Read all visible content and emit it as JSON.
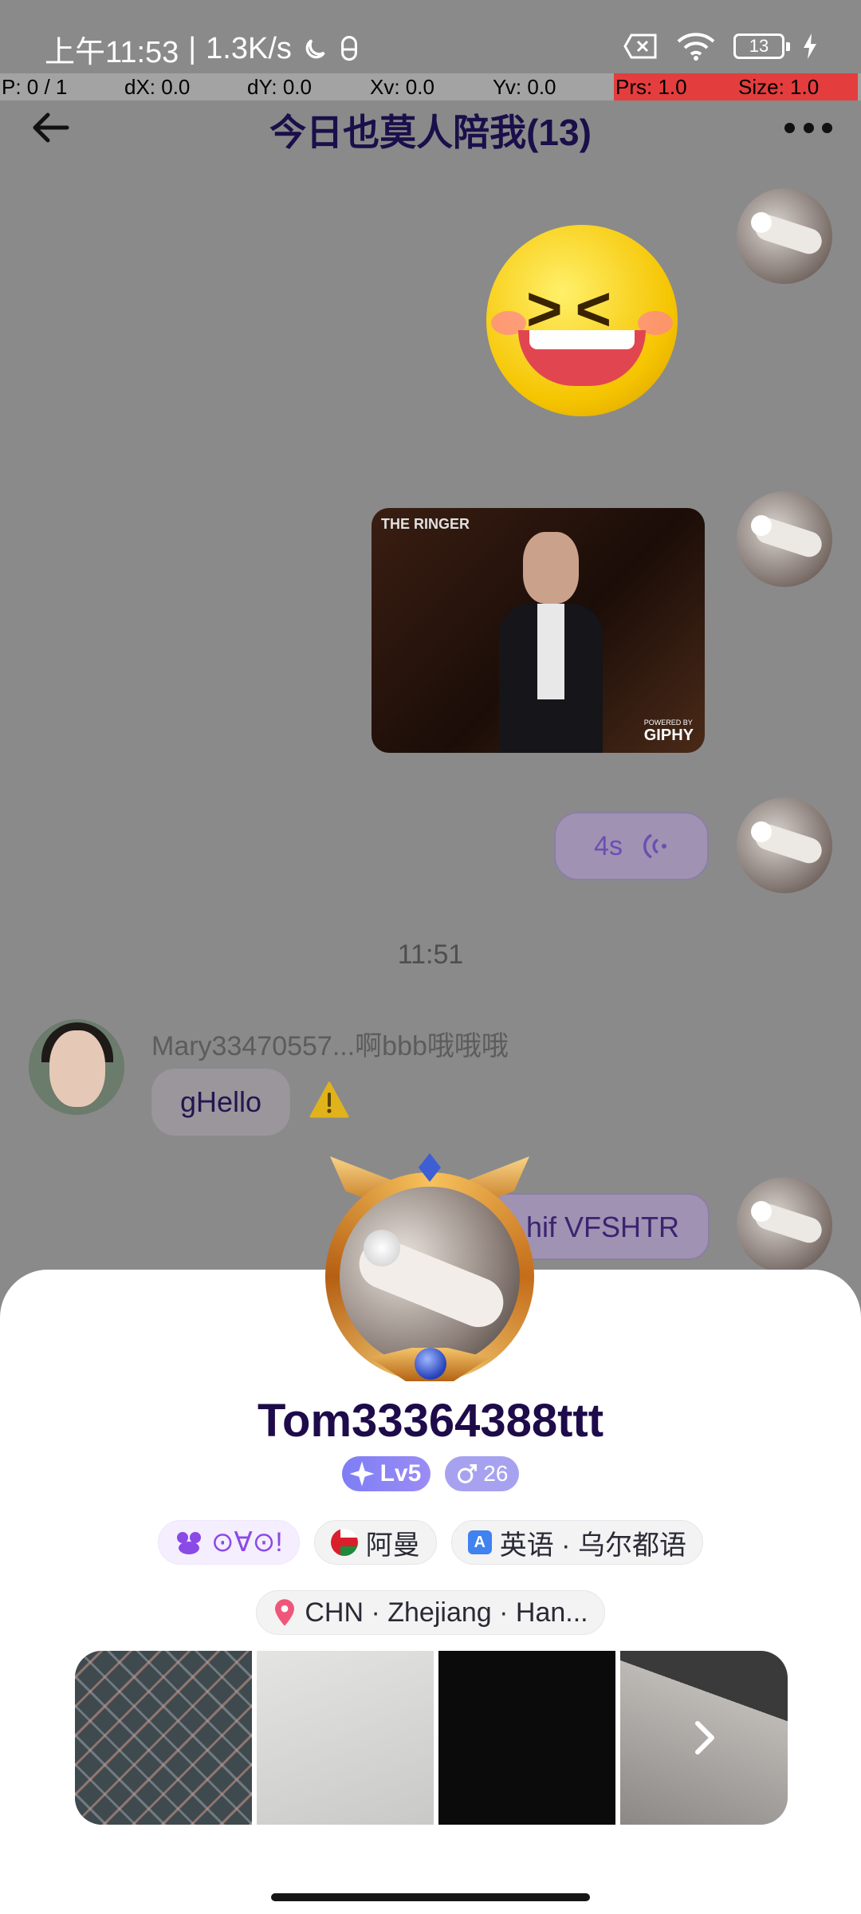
{
  "status_bar": {
    "time": "上午11:53",
    "network_speed": "1.3K/s",
    "battery": "13"
  },
  "debug_bar": {
    "cells": [
      "P: 0 / 1",
      "dX: 0.0",
      "dY: 0.0",
      "Xv: 0.0",
      "Yv: 0.0",
      "Prs: 1.0",
      "Size: 1.0"
    ]
  },
  "header": {
    "title": "今日也莫人陪我(13)"
  },
  "chat": {
    "gif_logo": "THE RINGER",
    "gif_powered": "POWERED BY",
    "gif_brand": "GIPHY",
    "voice_duration": "4s",
    "time_divider": "11:51",
    "sender_line": "Mary33470557...啊bbb哦哦哦",
    "other_message": "gHello",
    "self_message": "hif VFSHTR"
  },
  "profile": {
    "username": "Tom33364388ttt",
    "level": "Lv5",
    "gender_age": "26",
    "mood_tag": "⊙∀⊙!",
    "country_tag": "阿曼",
    "language_tag": "英语 · 乌尔都语",
    "location_tag": "CHN · Zhejiang · Han..."
  },
  "colors": {
    "accent_purple": "#8b49e6",
    "title_navy": "#1e0b4a",
    "level_badge": "#7e7ef5",
    "warning_yellow": "#e0b31c"
  }
}
